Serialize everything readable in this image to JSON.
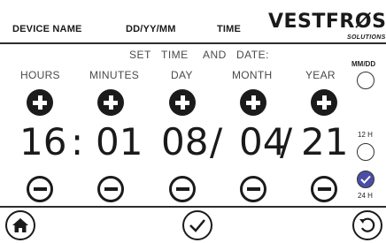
{
  "header": {
    "device_name": "DEVICE NAME",
    "date_format": "DD/YY/MM",
    "time": "TIME",
    "logo_main": "VESTFRØST",
    "logo_sub": "SOLUTIONS"
  },
  "set_line": {
    "w1": "SET",
    "w2": "TIME",
    "w3": "AND",
    "w4": "DATE:"
  },
  "fields": {
    "hours": {
      "label": "HOURS",
      "value": "16"
    },
    "minutes": {
      "label": "MINUTES",
      "value": "01"
    },
    "day": {
      "label": "DAY",
      "value": "08"
    },
    "month": {
      "label": "MONTH",
      "value": "04"
    },
    "year": {
      "label": "YEAR",
      "value": "21"
    }
  },
  "separators": {
    "time": ":",
    "date1": "/",
    "date2": "/"
  },
  "options": {
    "date_order": {
      "label": "MM/DD",
      "selected": false
    },
    "hour12": {
      "label": "12 H",
      "selected": false
    },
    "hour24": {
      "label": "24 H",
      "selected": true
    }
  },
  "icons": {
    "home": "home-icon",
    "confirm": "checkmark-icon",
    "back": "back-arrow-icon"
  },
  "colors": {
    "accent": "#4b4ea6",
    "dark": "#1b1b1b"
  }
}
